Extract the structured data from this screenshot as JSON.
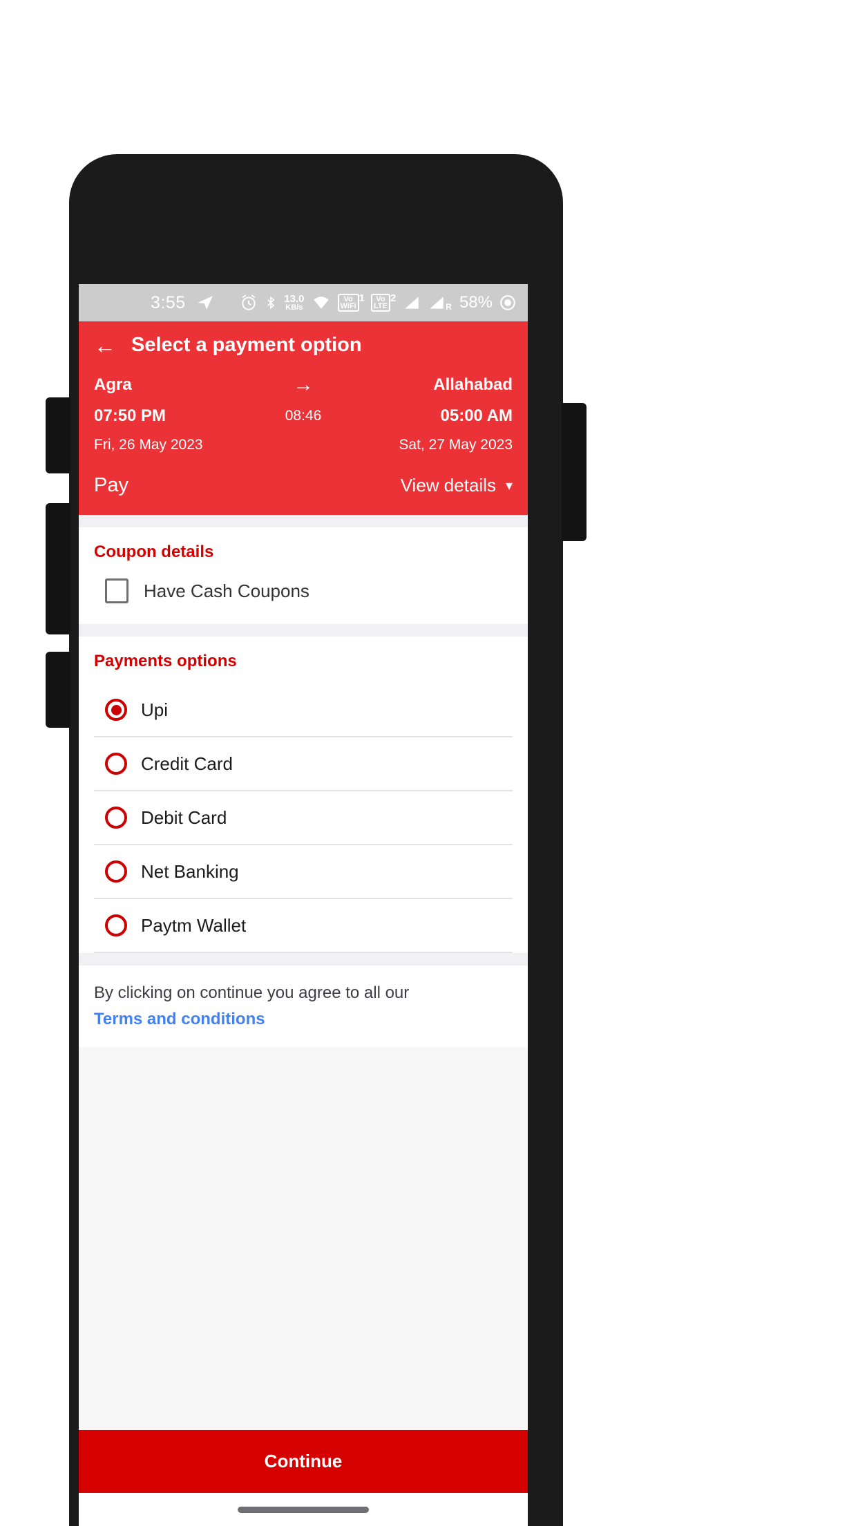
{
  "status_bar": {
    "time": "3:55",
    "telegram_icon": "telegram-send-icon",
    "alarm_icon": "alarm-clock-icon",
    "bluetooth_icon": "bluetooth-icon",
    "data_speed": "13.0",
    "data_speed_unit": "KB/s",
    "wifi_icon": "wifi-icon",
    "volte_wifi_label_top": "Vo",
    "volte_wifi_label_bottom": "WiFi",
    "volte_wifi_sim": "1",
    "volte_lte_label_top": "Vo",
    "volte_lte_label_bottom": "LTE",
    "volte_lte_sim": "2",
    "signal_1_icon": "signal-bars-icon",
    "signal_2_icon": "signal-bars-roaming-icon",
    "signal_2_suffix": "R",
    "battery_percent": "58%",
    "battery_icon": "battery-circle-icon"
  },
  "header": {
    "back_icon": "back-arrow-icon",
    "title": "Select a payment option",
    "background_color": "#ea3237"
  },
  "journey": {
    "origin_city": "Agra",
    "arrow_icon": "arrow-right-icon",
    "destination_city": "Allahabad",
    "departure_time": "07:50 PM",
    "duration": "08:46",
    "arrival_time": "05:00 AM",
    "departure_date": "Fri, 26 May 2023",
    "arrival_date": "Sat, 27 May 2023",
    "pay_label": "Pay",
    "view_details_label": "View details",
    "chevron_icon": "chevron-down-icon"
  },
  "coupon": {
    "section_title": "Coupon details",
    "checkbox_label": "Have Cash Coupons",
    "checked": false
  },
  "payments": {
    "section_title": "Payments options",
    "accent_color": "#cc0000",
    "options": [
      {
        "label": "Upi",
        "selected": true
      },
      {
        "label": "Credit Card",
        "selected": false
      },
      {
        "label": "Debit Card",
        "selected": false
      },
      {
        "label": "Net Banking",
        "selected": false
      },
      {
        "label": "Paytm Wallet",
        "selected": false
      }
    ]
  },
  "terms": {
    "text": "By clicking on continue you agree to all our",
    "link_label": "Terms and conditions",
    "link_color": "#4281ef"
  },
  "footer": {
    "continue_label": "Continue",
    "continue_color": "#d50000"
  }
}
